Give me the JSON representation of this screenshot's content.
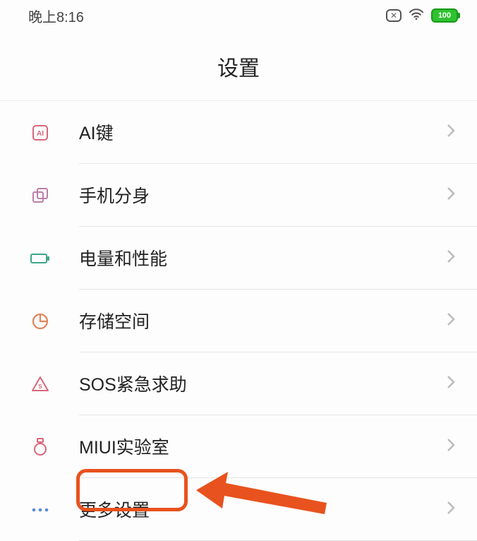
{
  "status_bar": {
    "time": "晚上8:16",
    "no_sim_glyph": "✕",
    "battery_pct": "100"
  },
  "header": {
    "title": "设置"
  },
  "items": [
    {
      "key": "ai",
      "label": "AI键",
      "icon_color": "#d8667a",
      "icon": "ai"
    },
    {
      "key": "dual",
      "label": "手机分身",
      "icon_color": "#bb7fa9",
      "icon": "dual"
    },
    {
      "key": "battery",
      "label": "电量和性能",
      "icon_color": "#3da58a",
      "icon": "battery"
    },
    {
      "key": "storage",
      "label": "存储空间",
      "icon_color": "#e0865a",
      "icon": "storage"
    },
    {
      "key": "sos",
      "label": "SOS紧急求助",
      "icon_color": "#d8667a",
      "icon": "sos"
    },
    {
      "key": "lab",
      "label": "MIUI实验室",
      "icon_color": "#d8667a",
      "icon": "lab"
    },
    {
      "key": "more",
      "label": "更多设置",
      "icon_color": "#5b8bd4",
      "icon": "more",
      "highlighted": true
    }
  ]
}
